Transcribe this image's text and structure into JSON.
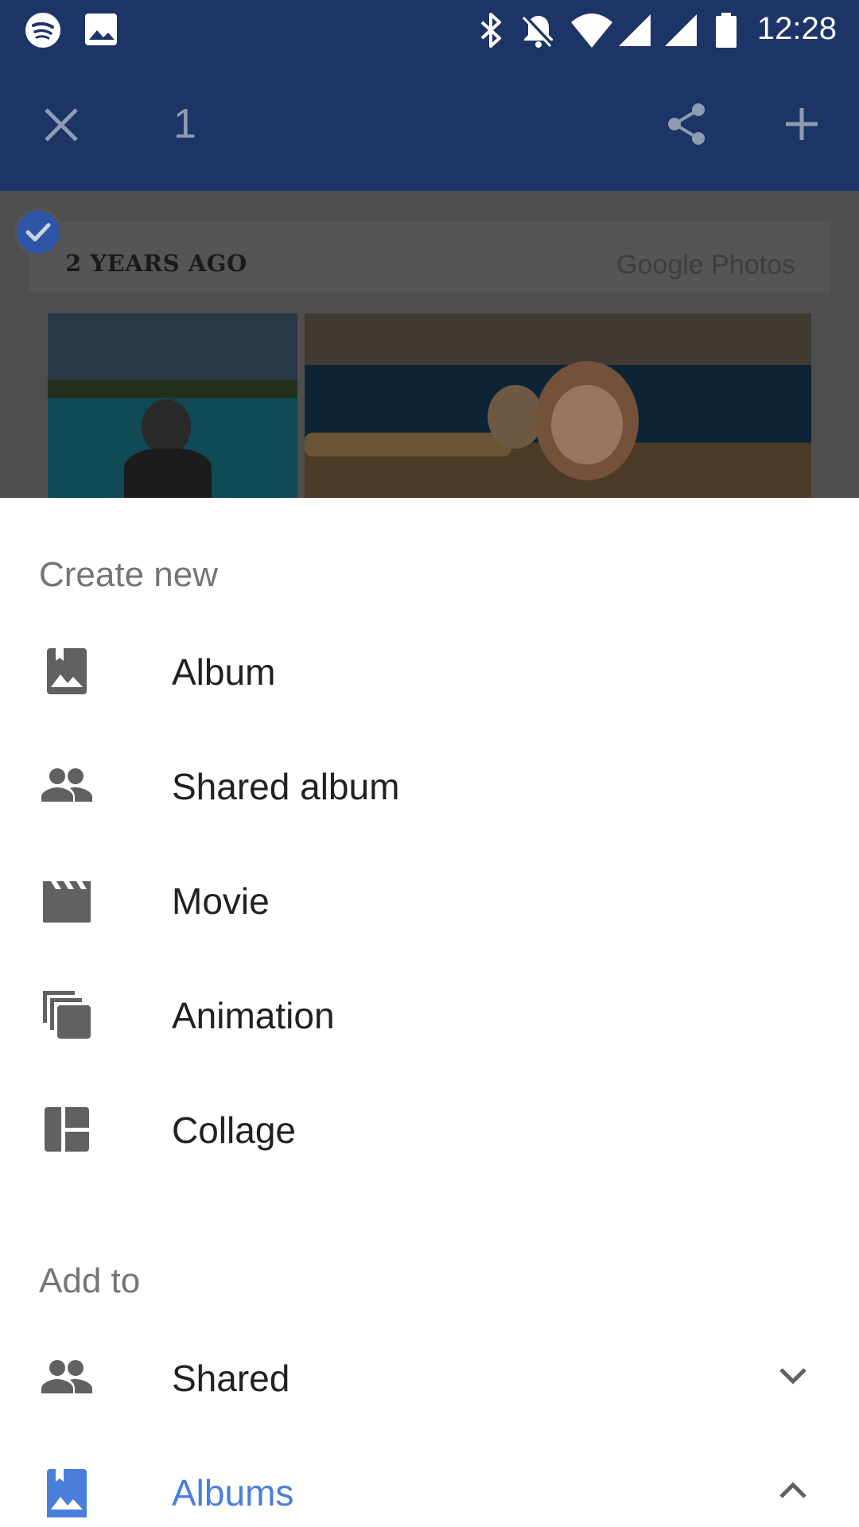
{
  "status_bar": {
    "time": "12:28",
    "icons": [
      "spotify-icon",
      "image-icon",
      "bluetooth-icon",
      "notifications-off-icon",
      "wifi-icon",
      "signal-icon",
      "signal-icon",
      "battery-icon"
    ]
  },
  "app_bar": {
    "selection_count": "1",
    "icons": [
      "close-icon",
      "share-icon",
      "add-icon"
    ]
  },
  "memory_card": {
    "title": "2 YEARS AGO",
    "brand": "Google Photos"
  },
  "sheet": {
    "create_new_title": "Create new",
    "create_items": [
      {
        "label": "Album",
        "icon": "photo-album-icon"
      },
      {
        "label": "Shared album",
        "icon": "people-icon"
      },
      {
        "label": "Movie",
        "icon": "movie-icon"
      },
      {
        "label": "Animation",
        "icon": "animation-icon"
      },
      {
        "label": "Collage",
        "icon": "collage-icon"
      }
    ],
    "add_to_title": "Add to",
    "add_items": [
      {
        "label": "Shared",
        "icon": "people-icon",
        "state": "collapsed"
      },
      {
        "label": "Albums",
        "icon": "photo-album-icon",
        "state": "expanded"
      }
    ]
  },
  "colors": {
    "app_bar": "#1d3566",
    "accent": "#4a7fd9",
    "icon_gray": "#616161",
    "text": "#212121",
    "subheader": "#757575"
  }
}
